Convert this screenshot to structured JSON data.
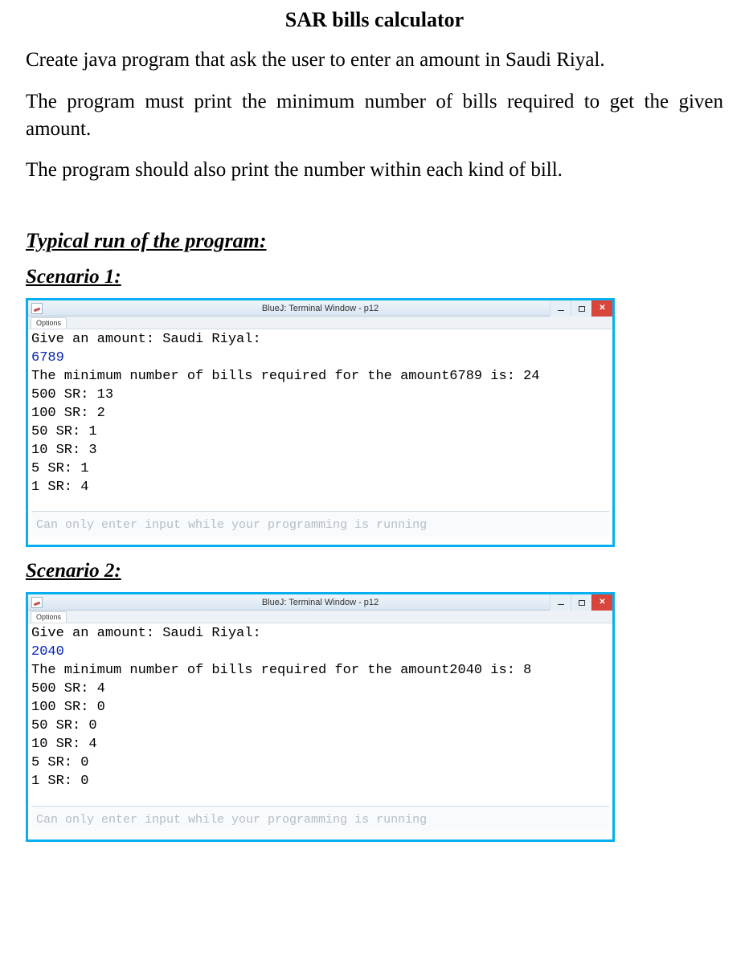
{
  "title": "SAR bills calculator",
  "paragraphs": [
    "Create java program that ask the user to enter an amount in Saudi Riyal.",
    "The program must print the minimum number of bills required to get the given amount.",
    "The program should also print the number within each kind of bill."
  ],
  "section_heading": "Typical run of the program:",
  "terminal_title": "BlueJ: Terminal Window - p12",
  "options_label": "Options",
  "footer_text": "Can only enter input while your programming is running",
  "scenario1": {
    "heading": "Scenario 1:",
    "lines": [
      {
        "text": "Give an amount: Saudi Riyal:",
        "input": false
      },
      {
        "text": "6789",
        "input": true
      },
      {
        "text": "The minimum number of bills required for the amount6789 is: 24",
        "input": false
      },
      {
        "text": "500 SR: 13",
        "input": false
      },
      {
        "text": "100 SR: 2",
        "input": false
      },
      {
        "text": "50 SR: 1",
        "input": false
      },
      {
        "text": "10 SR: 3",
        "input": false
      },
      {
        "text": "5 SR: 1",
        "input": false
      },
      {
        "text": "1 SR: 4",
        "input": false
      }
    ]
  },
  "scenario2": {
    "heading": "Scenario 2:",
    "lines": [
      {
        "text": "Give an amount: Saudi Riyal:",
        "input": false
      },
      {
        "text": "2040",
        "input": true
      },
      {
        "text": "The minimum number of bills required for the amount2040 is: 8",
        "input": false
      },
      {
        "text": "500 SR: 4",
        "input": false
      },
      {
        "text": "100 SR: 0",
        "input": false
      },
      {
        "text": "50 SR: 0",
        "input": false
      },
      {
        "text": "10 SR: 4",
        "input": false
      },
      {
        "text": "5 SR: 0",
        "input": false
      },
      {
        "text": "1 SR: 0",
        "input": false
      }
    ]
  }
}
